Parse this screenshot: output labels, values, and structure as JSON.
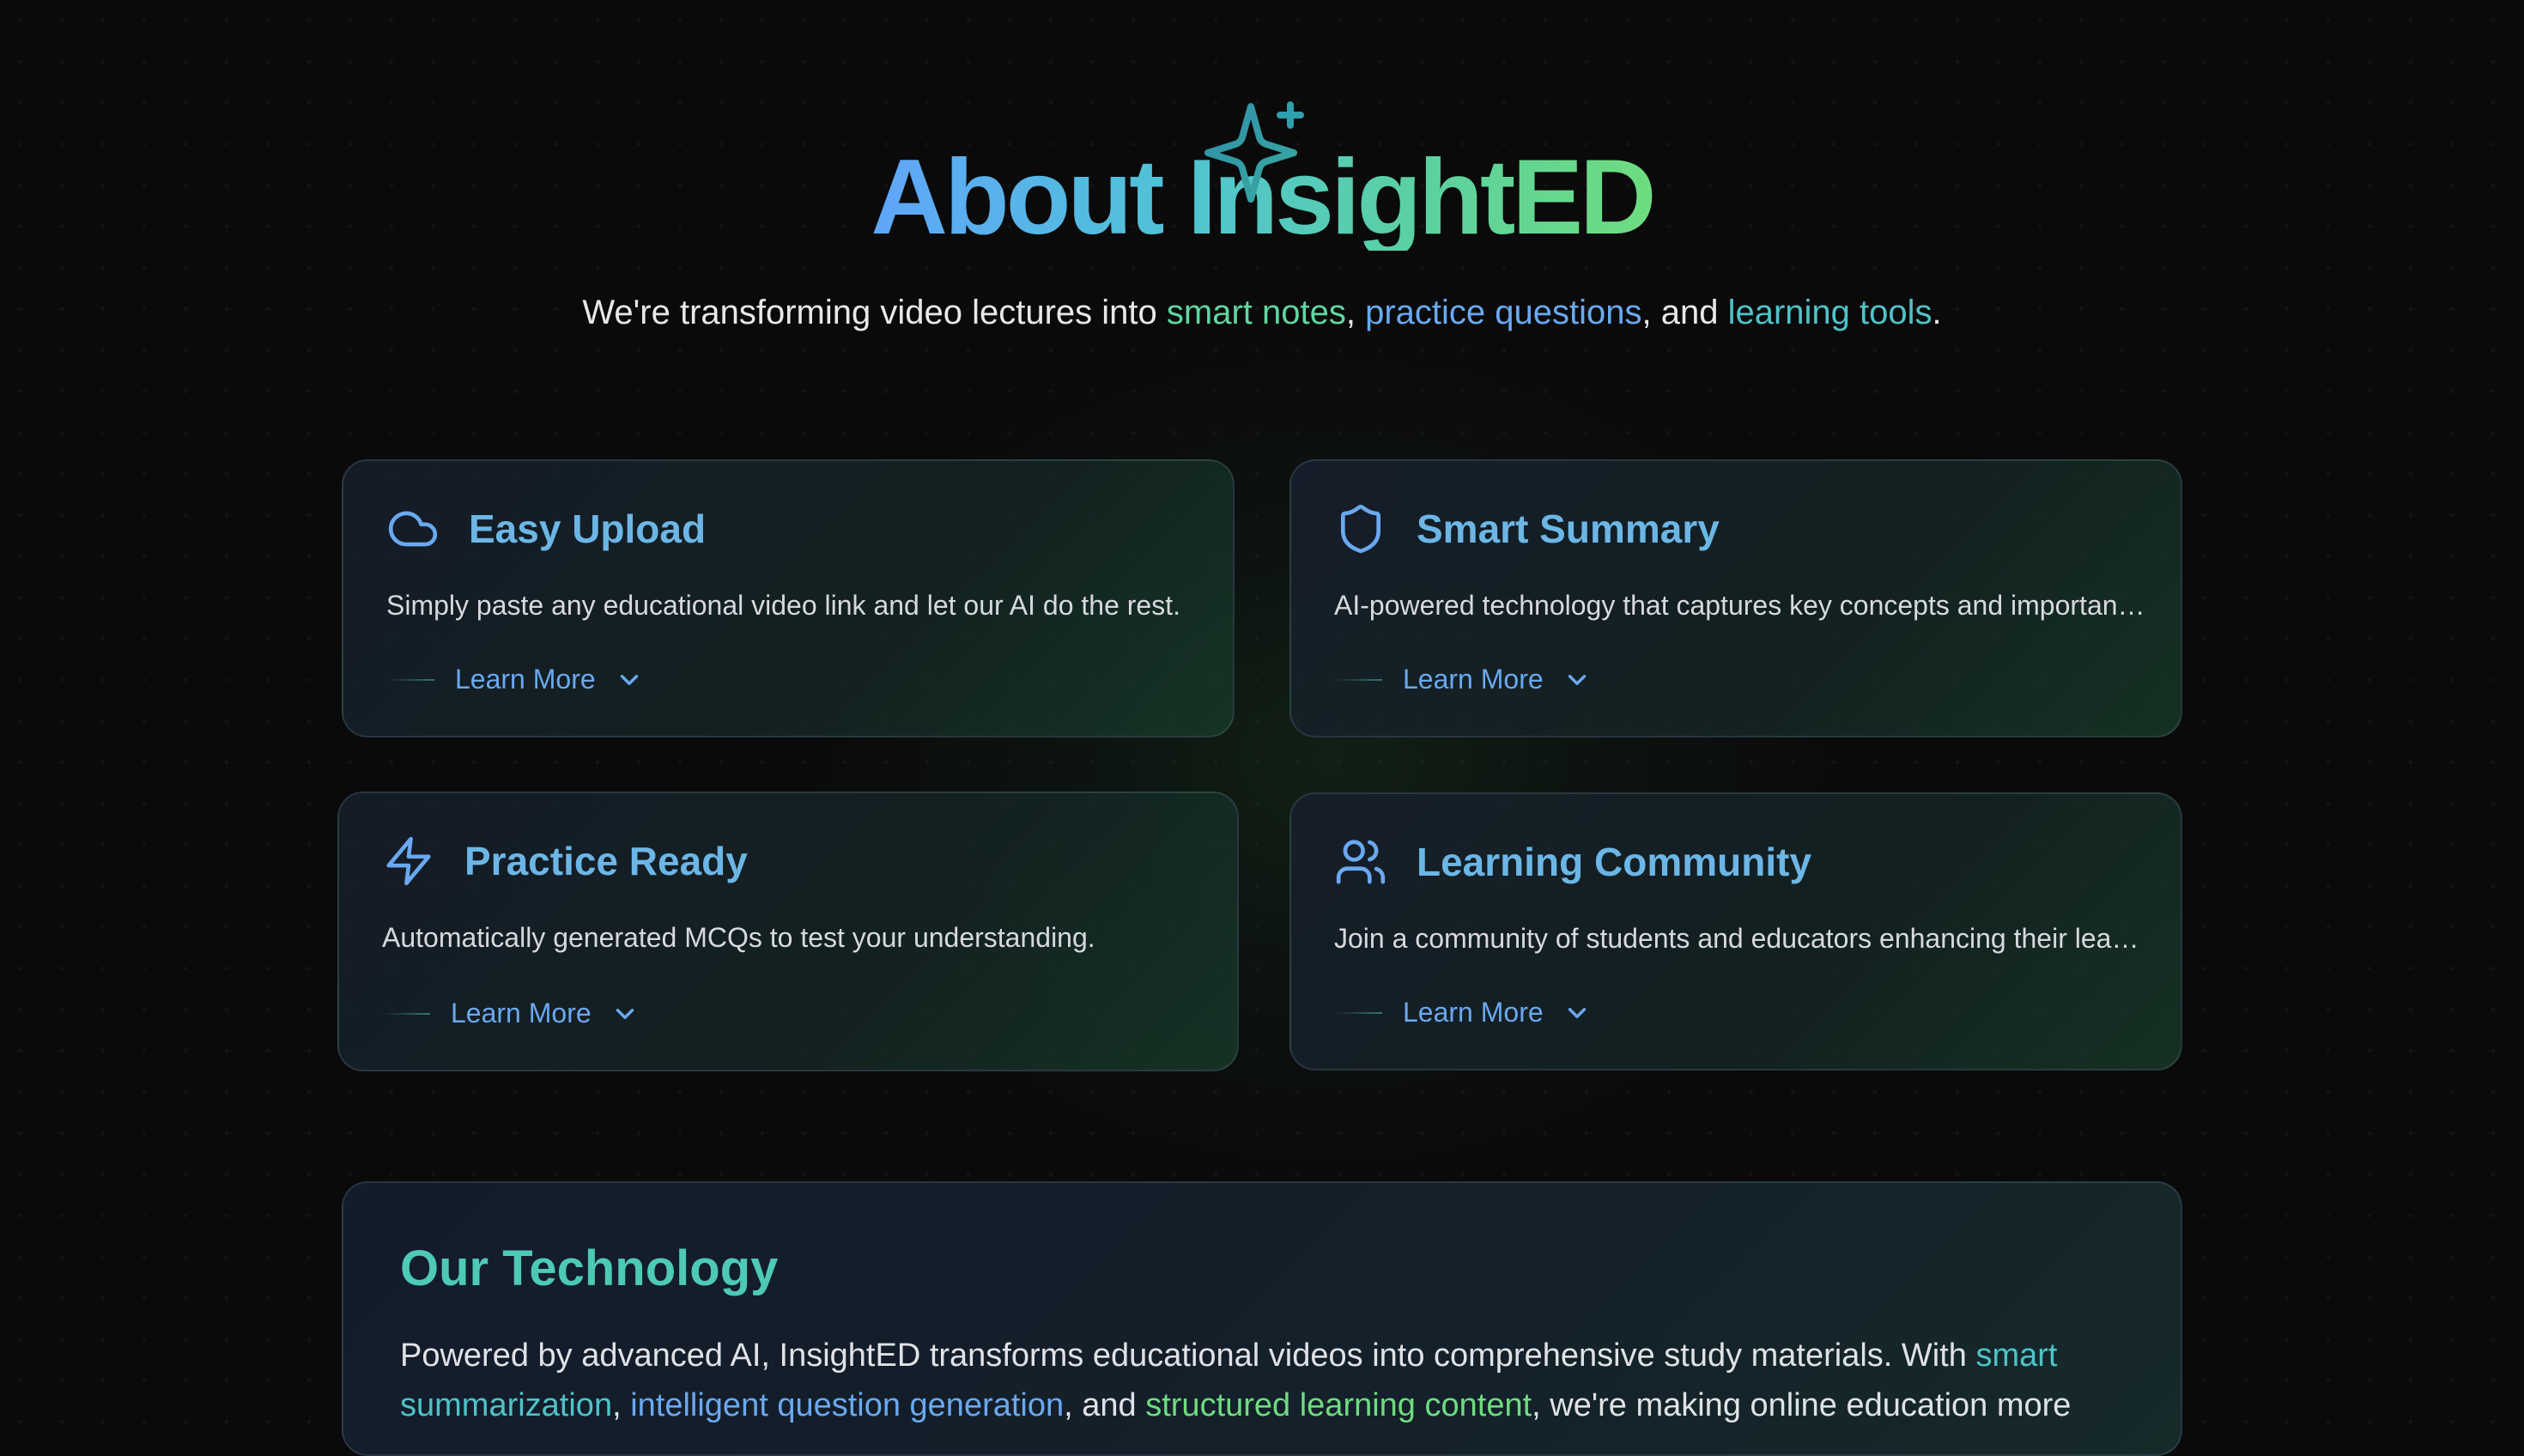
{
  "hero": {
    "title": "About InsightED",
    "subtitle_parts": {
      "prefix": "We're transforming video lectures into ",
      "link1": "smart notes",
      "sep1": ", ",
      "link2": "practice questions",
      "sep2": ", and ",
      "link3": "learning tools",
      "suffix": "."
    }
  },
  "features": [
    {
      "title": "Easy Upload",
      "icon": "cloud-icon",
      "description": "Simply paste any educational video link and let our AI do the rest.",
      "cta": "Learn More"
    },
    {
      "title": "Smart Summary",
      "icon": "shield-icon",
      "description": "AI-powered technology that captures key concepts and important details.",
      "cta": "Learn More"
    },
    {
      "title": "Practice Ready",
      "icon": "lightning-icon",
      "description": "Automatically generated MCQs to test your understanding.",
      "cta": "Learn More"
    },
    {
      "title": "Learning Community",
      "icon": "users-icon",
      "description": "Join a community of students and educators enhancing their learning.",
      "cta": "Learn More"
    }
  ],
  "technology": {
    "title": "Our Technology",
    "body_parts": {
      "p1": "Powered by advanced AI, InsightED transforms educational videos into comprehensive study materials. With ",
      "h1": "smart summarization",
      "p2": ", ",
      "h2": "intelligent question generation",
      "p3": ", and ",
      "h3": "structured learning content",
      "p4": ", we're making online education more"
    }
  },
  "colors": {
    "background": "#0a0a0a",
    "accent_blue": "#60a5fa",
    "accent_green": "#6edc7f",
    "accent_teal": "#4ec9b5"
  }
}
